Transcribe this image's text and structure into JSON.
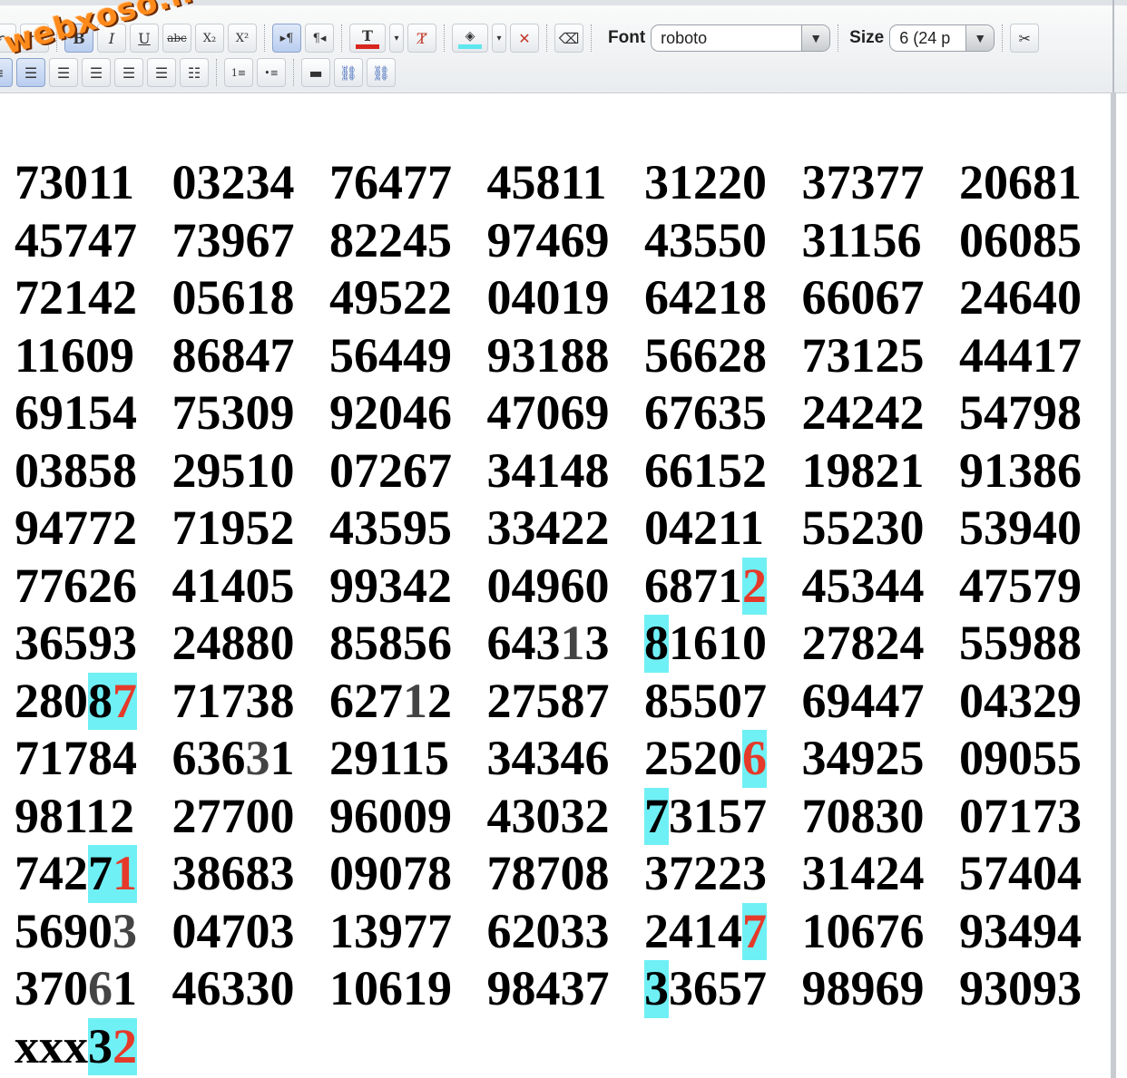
{
  "watermark": "webxoso.net",
  "toolbar": {
    "undo_icon": "undo-icon",
    "redo_icon": "redo-icon",
    "bold_label": "B",
    "italic_label": "I",
    "underline_label": "U",
    "strike_label": "abc",
    "subscript_label": "X₂",
    "superscript_label": "X²",
    "ltr_label": "▸¶",
    "rtl_label": "¶◂",
    "text_color_label": "T",
    "font_label": "Font",
    "font_value": "roboto",
    "size_label": "Size",
    "size_value": "6 (24 p",
    "colors": {
      "text_color_bar": "#d8261e",
      "bg_color_bar": "#5fe7ef"
    }
  },
  "numbers": [
    [
      "73011",
      "03234",
      "76477",
      "45811",
      "31220",
      "37377",
      "20681"
    ],
    [
      "45747",
      "73967",
      "82245",
      "97469",
      "43550",
      "31156",
      "06085"
    ],
    [
      "72142",
      "05618",
      "49522",
      "04019",
      "64218",
      "66067",
      "24640"
    ],
    [
      "11609",
      "86847",
      "56449",
      "93188",
      "56628",
      "73125",
      "44417"
    ],
    [
      "69154",
      "75309",
      "92046",
      "47069",
      "67635",
      "24242",
      "54798"
    ],
    [
      "03858",
      "29510",
      "07267",
      "34148",
      "66152",
      "19821",
      "91386"
    ],
    [
      "94772",
      "71952",
      "43595",
      "33422",
      "04211",
      "55230",
      "53940"
    ],
    [
      "77626",
      "41405",
      "99342",
      "04960",
      "68712",
      "45344",
      "47579"
    ],
    [
      "36593",
      "24880",
      "85856",
      "64313",
      "81610",
      "27824",
      "55988"
    ],
    [
      "28087",
      "71738",
      "62712",
      "27587",
      "85507",
      "69447",
      "04329"
    ],
    [
      "71784",
      "63631",
      "29115",
      "34346",
      "25206",
      "34925",
      "09055"
    ],
    [
      "98112",
      "27700",
      "96009",
      "43032",
      "73157",
      "70830",
      "07173"
    ],
    [
      "74271",
      "38683",
      "09078",
      "78708",
      "37223",
      "31424",
      "57404"
    ],
    [
      "56903",
      "04703",
      "13977",
      "62033",
      "24147",
      "10676",
      "93494"
    ],
    [
      "37061",
      "46330",
      "10619",
      "98437",
      "33657",
      "98969",
      "93093"
    ],
    [
      "xxx32"
    ]
  ],
  "highlights": [
    {
      "row": 7,
      "col": 4,
      "chars": [
        4
      ],
      "red": [
        4
      ]
    },
    {
      "row": 8,
      "col": 4,
      "chars": [
        0
      ],
      "red": []
    },
    {
      "row": 9,
      "col": 0,
      "chars": [
        3,
        4
      ],
      "red": [
        4
      ]
    },
    {
      "row": 10,
      "col": 4,
      "chars": [
        4
      ],
      "red": [
        4
      ]
    },
    {
      "row": 11,
      "col": 4,
      "chars": [
        0
      ],
      "red": []
    },
    {
      "row": 12,
      "col": 0,
      "chars": [
        3,
        4
      ],
      "red": [
        4
      ]
    },
    {
      "row": 13,
      "col": 4,
      "chars": [
        4
      ],
      "red": [
        4
      ]
    },
    {
      "row": 14,
      "col": 4,
      "chars": [
        0
      ],
      "red": []
    },
    {
      "row": 15,
      "col": 0,
      "chars": [
        3,
        4
      ],
      "red": [
        4
      ]
    }
  ],
  "dimmed": [
    {
      "row": 8,
      "col": 3,
      "chars": [
        3
      ]
    },
    {
      "row": 9,
      "col": 2,
      "chars": [
        3
      ]
    },
    {
      "row": 10,
      "col": 1,
      "chars": [
        3
      ]
    },
    {
      "row": 13,
      "col": 0,
      "chars": [
        4
      ]
    },
    {
      "row": 14,
      "col": 0,
      "chars": [
        3
      ]
    }
  ]
}
